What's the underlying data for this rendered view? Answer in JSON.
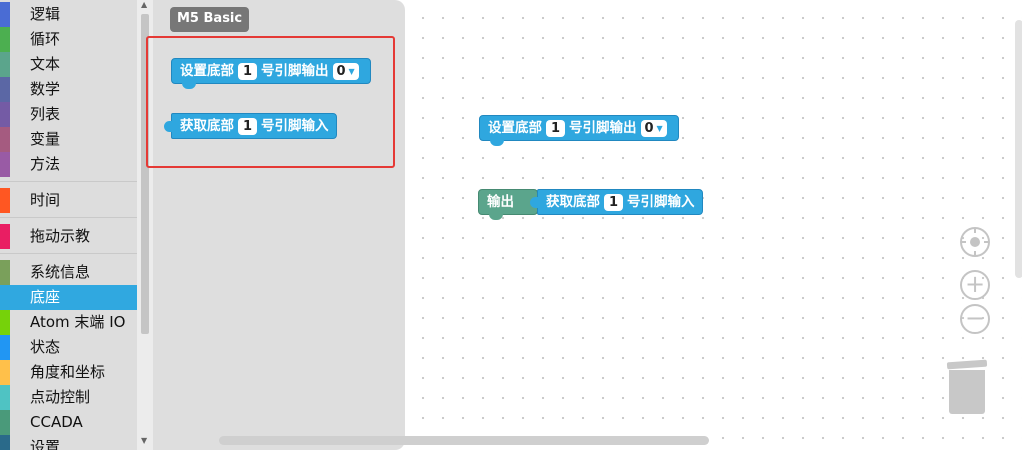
{
  "sidebar": {
    "categories": [
      {
        "label": "逻辑",
        "color": "#4a6cd4"
      },
      {
        "label": "循环",
        "color": "#4caf50"
      },
      {
        "label": "文本",
        "color": "#5ba58c"
      },
      {
        "label": "数学",
        "color": "#5b67a5"
      },
      {
        "label": "列表",
        "color": "#745ba5"
      },
      {
        "label": "变量",
        "color": "#a55b80"
      },
      {
        "label": "方法",
        "color": "#995ba5"
      },
      {
        "label": "时间",
        "color": "#ff5722"
      },
      {
        "label": "拖动示教",
        "color": "#e91e63"
      },
      {
        "label": "系统信息",
        "color": "#7aa05b"
      },
      {
        "label": "底座",
        "color": "#2fa7df"
      },
      {
        "label": "Atom 末端 IO",
        "color": "#76d20a"
      },
      {
        "label": "状态",
        "color": "#2196f3"
      },
      {
        "label": "角度和坐标",
        "color": "#ffc04a"
      },
      {
        "label": "点动控制",
        "color": "#4fc3c3"
      },
      {
        "label": "CCADA",
        "color": "#4a9a7a"
      },
      {
        "label": "设置",
        "color": "#2a6a8a"
      }
    ],
    "selected": "底座"
  },
  "flyout": {
    "label": "M5 Basic",
    "blocks": {
      "set_pin": {
        "prefix": "设置底部",
        "pin": "1",
        "suffix": "号引脚输出",
        "value": "0"
      },
      "get_pin": {
        "prefix": "获取底部",
        "pin": "1",
        "suffix": "号引脚输入"
      }
    }
  },
  "workspace": {
    "set_pin": {
      "prefix": "设置底部",
      "pin": "1",
      "suffix": "号引脚输出",
      "value": "0"
    },
    "output": {
      "label": "输出"
    },
    "get_pin": {
      "prefix": "获取底部",
      "pin": "1",
      "suffix": "号引脚输入"
    }
  },
  "controls": {
    "center_icon": "crosshair-icon",
    "zoom_in_icon": "plus-icon",
    "zoom_out_icon": "minus-icon",
    "trash_icon": "trash-icon"
  },
  "colors": {
    "block_blue": "#2fa7df",
    "block_teal": "#5ba58c",
    "selected_category": "#30a8e0",
    "highlight": "#e53935"
  }
}
